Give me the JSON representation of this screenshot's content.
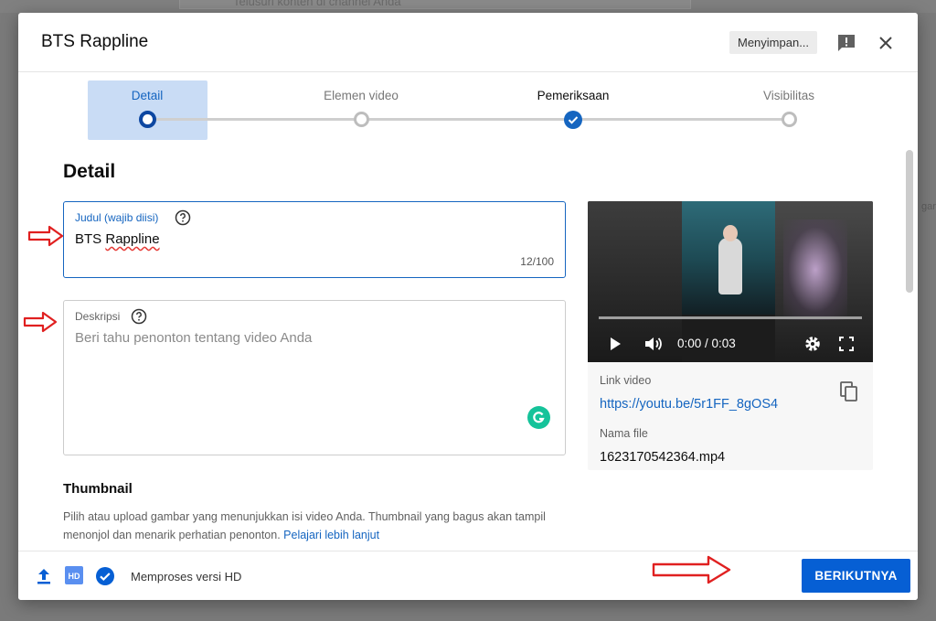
{
  "background": {
    "search_placeholder": "Telusuri konten di channel Anda",
    "edge_text": "gar"
  },
  "dialog": {
    "title": "BTS Rappline",
    "saving_status": "Menyimpan...",
    "feedback_icon": "report-feedback-icon",
    "close_icon": "close-icon"
  },
  "stepper": {
    "steps": [
      {
        "label": "Detail",
        "state": "active"
      },
      {
        "label": "Elemen video",
        "state": "pending"
      },
      {
        "label": "Pemeriksaan",
        "state": "done"
      },
      {
        "label": "Visibilitas",
        "state": "pending"
      }
    ],
    "colors": {
      "active": "#0d47a1",
      "done": "#1565c0",
      "pending": "#bdbdbd"
    }
  },
  "details": {
    "heading": "Detail",
    "title_field": {
      "label": "Judul (wajib diisi)",
      "value_word1": "BTS",
      "value_word2": "Rappline",
      "counter": "12/100"
    },
    "description_field": {
      "label": "Deskripsi",
      "placeholder": "Beri tahu penonton tentang video Anda"
    }
  },
  "thumbnail": {
    "heading": "Thumbnail",
    "text": "Pilih atau upload gambar yang menunjukkan isi video Anda. Thumbnail yang bagus akan tampil menonjol dan menarik perhatian penonton.",
    "link": "Pelajari lebih lanjut"
  },
  "video_card": {
    "time": "0:00 / 0:03",
    "link_label": "Link video",
    "link_url": "https://youtu.be/5r1FF_8gOS4",
    "filename_label": "Nama file",
    "filename": "1623170542364.mp4"
  },
  "footer": {
    "status": "Memproses versi HD",
    "hd_badge": "HD",
    "next_label": "BERIKUTNYA",
    "accent": "#065fd4"
  },
  "annotation_color": "#e02020"
}
